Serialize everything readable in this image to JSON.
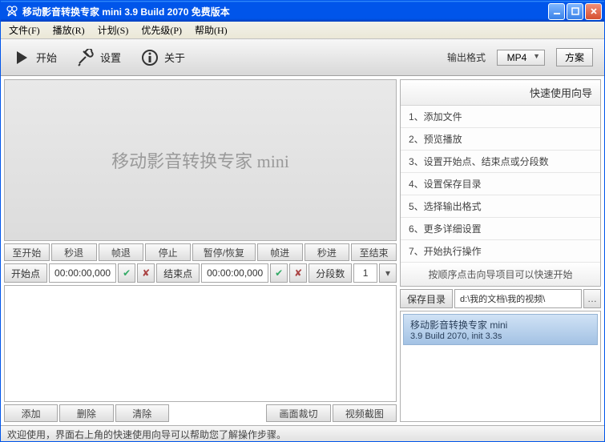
{
  "title": "移动影音转换专家 mini 3.9 Build 2070 免费版本",
  "menu": [
    "文件(F)",
    "播放(R)",
    "计划(S)",
    "优先级(P)",
    "帮助(H)"
  ],
  "toolbar": {
    "start": "开始",
    "settings": "设置",
    "about": "关于",
    "outfmt_label": "输出格式",
    "outfmt_value": "MP4",
    "scheme": "方案"
  },
  "preview_watermark": "移动影音转换专家 mini",
  "playback": [
    "至开始",
    "秒退",
    "帧退",
    "停止",
    "暂停/恢复",
    "帧进",
    "秒进",
    "至结束"
  ],
  "time": {
    "start_label": "开始点",
    "start_val": "00:00:00,000",
    "end_label": "结束点",
    "end_val": "00:00:00,000",
    "seg_label": "分段数",
    "seg_val": "1"
  },
  "listctrl": {
    "add": "添加",
    "del": "删除",
    "clear": "清除",
    "imgcrop": "画面裁切",
    "vidcrop": "视频截图"
  },
  "guide": {
    "title": "快速使用向导",
    "items": [
      "1、添加文件",
      "2、预览播放",
      "3、设置开始点、结束点或分段数",
      "4、设置保存目录",
      "5、选择输出格式",
      "6、更多详细设置",
      "7、开始执行操作"
    ],
    "foot": "按顺序点击向导项目可以快速开始"
  },
  "save": {
    "label": "保存目录",
    "path": "d:\\我的文档\\我的视频\\"
  },
  "log": {
    "line1": "移动影音转换专家 mini",
    "line2": "3.9 Build 2070, init 3.3s"
  },
  "status": "欢迎使用，界面右上角的快速使用向导可以帮助您了解操作步骤。"
}
